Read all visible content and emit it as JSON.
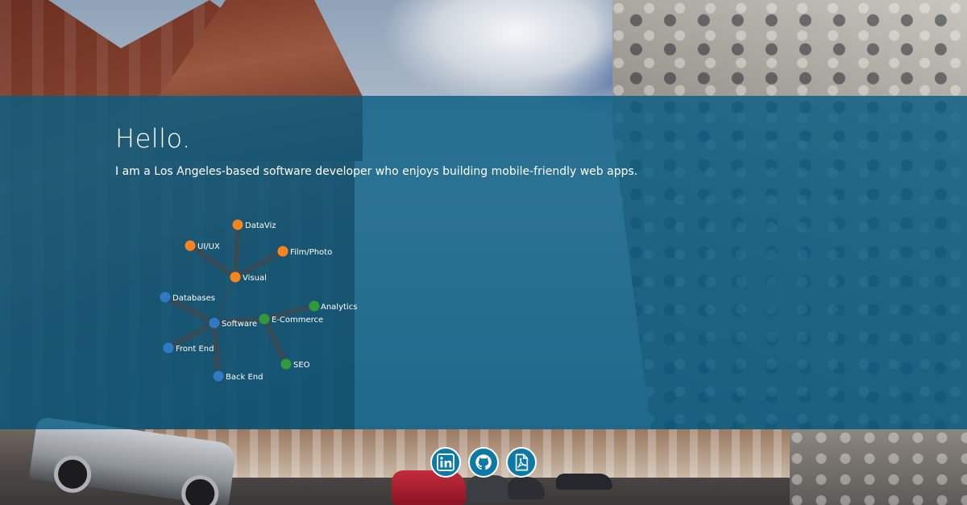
{
  "hero": {
    "greeting": "Hello.",
    "intro": "I am a Los Angeles-based software developer who enjoys building mobile-friendly web apps."
  },
  "skills_graph": {
    "colors": {
      "visual": "#f7851e",
      "software": "#2f7ac4",
      "ecommerce": "#2e9a3a",
      "link": "#3a4a52"
    },
    "nodes": [
      {
        "id": "dataviz",
        "label": "DataViz",
        "group": "visual"
      },
      {
        "id": "uiux",
        "label": "UI/UX",
        "group": "visual"
      },
      {
        "id": "filmphoto",
        "label": "Film/Photo",
        "group": "visual"
      },
      {
        "id": "visual",
        "label": "Visual",
        "group": "visual"
      },
      {
        "id": "databases",
        "label": "Databases",
        "group": "software"
      },
      {
        "id": "software",
        "label": "Software",
        "group": "software"
      },
      {
        "id": "frontend",
        "label": "Front End",
        "group": "software"
      },
      {
        "id": "backend",
        "label": "Back End",
        "group": "software"
      },
      {
        "id": "analytics",
        "label": "Analytics",
        "group": "ecommerce"
      },
      {
        "id": "ecommerce",
        "label": "E-Commerce",
        "group": "ecommerce"
      },
      {
        "id": "seo",
        "label": "SEO",
        "group": "ecommerce"
      }
    ],
    "links": [
      [
        "visual",
        "dataviz"
      ],
      [
        "visual",
        "uiux"
      ],
      [
        "visual",
        "filmphoto"
      ],
      [
        "visual",
        "software"
      ],
      [
        "software",
        "databases"
      ],
      [
        "software",
        "frontend"
      ],
      [
        "software",
        "backend"
      ],
      [
        "software",
        "ecommerce"
      ],
      [
        "ecommerce",
        "analytics"
      ],
      [
        "ecommerce",
        "seo"
      ]
    ]
  },
  "social": {
    "items": [
      {
        "icon": "linkedin-icon"
      },
      {
        "icon": "github-icon"
      },
      {
        "icon": "pdf-icon"
      }
    ]
  }
}
